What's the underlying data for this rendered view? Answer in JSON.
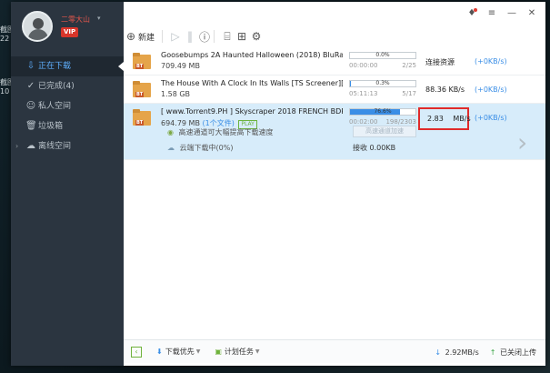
{
  "desktop": {
    "labels": [
      "截图",
      "22",
      "截图",
      "10"
    ]
  },
  "user": {
    "name": "二零大山",
    "vip": "VIP"
  },
  "nav": [
    {
      "label": "正在下载",
      "icon": "download-icon",
      "active": true
    },
    {
      "label": "已完成(4)",
      "icon": "check-circle-icon"
    },
    {
      "label": "私人空间",
      "icon": "person-icon"
    },
    {
      "label": "垃圾箱",
      "icon": "trash-icon"
    },
    {
      "label": "离线空间",
      "icon": "cloud-icon"
    }
  ],
  "toolbar": {
    "new_label": "新建"
  },
  "downloads": [
    {
      "name": "Goosebumps 2A Haunted Halloween (2018) BluRay x264",
      "size": "709.49 MB",
      "progress": 0.0,
      "progress_text": "0.0%",
      "eta": "00:00:00",
      "pieces": "2/25",
      "status": "连接资源",
      "accel": "(+0KB/s)"
    },
    {
      "name": "The House With A Clock In Its Walls [TS Screener][Latino...",
      "size": "1.58 GB",
      "progress": 0.3,
      "progress_text": "0.3%",
      "eta": "05:11:13",
      "pieces": "5/17",
      "speed": "88.36  KB/s",
      "accel": "(+0KB/s)"
    },
    {
      "name": "[ www.Torrent9.PH ] Skyscraper 2018 FRENCH BDRip Xv...",
      "size": "694.79 MB",
      "files_link": "(1个文件)",
      "play": "PLAY",
      "progress": 76.6,
      "progress_text": "76.6%",
      "eta": "00:02:00",
      "pieces": "198/2303",
      "speed_value": "2.83",
      "speed_unit": "MB/s",
      "accel": "(+0KB/s)",
      "hint": "高速通道可大幅提高下载速度",
      "fast_button": "高速通道加速",
      "cloud_line": "云端下载中(0%)",
      "recv": "接收 0.00KB"
    }
  ],
  "bottom": {
    "priority": "下载优先",
    "schedule": "计划任务",
    "down_speed": "2.92MB/s",
    "upload": "已关闭上传"
  }
}
